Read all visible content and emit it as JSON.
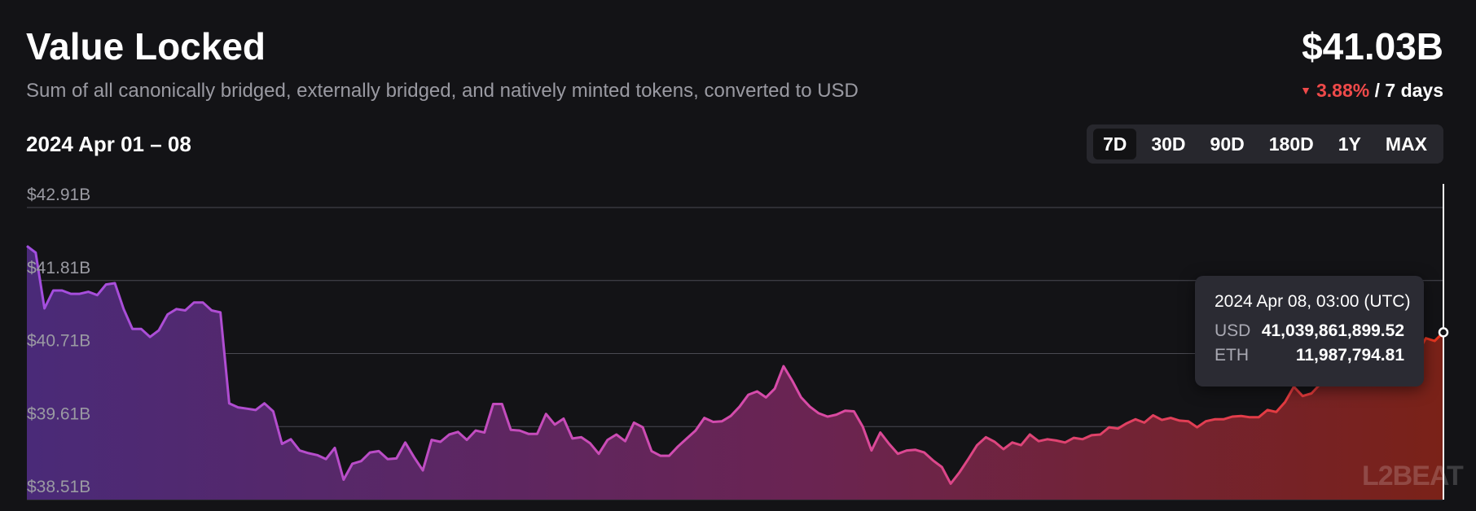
{
  "header": {
    "title": "Value Locked",
    "subtitle": "Sum of all canonically bridged, externally bridged, and natively minted tokens, converted to USD",
    "total_value": "$41.03B",
    "change_pct": "3.88%",
    "change_period": "/ 7 days",
    "date_range": "2024 Apr 01 – 08"
  },
  "tabs": [
    "7D",
    "30D",
    "90D",
    "180D",
    "1Y",
    "MAX"
  ],
  "active_tab": "7D",
  "tooltip": {
    "title": "2024 Apr 08, 03:00 (UTC)",
    "rows": [
      {
        "label": "USD",
        "value": "41,039,861,899.52"
      },
      {
        "label": "ETH",
        "value": "11,987,794.81"
      }
    ]
  },
  "watermark": "L2BEAT",
  "colors": {
    "background": "#131316",
    "negative": "#ef4a4a",
    "gradient_start": "#a24ee0",
    "gradient_mid": "#d94ba7",
    "gradient_end": "#e8361e"
  },
  "chart_data": {
    "type": "area",
    "y_tick_labels": [
      "$42.91B",
      "$41.81B",
      "$40.71B",
      "$39.61B",
      "$38.51B"
    ],
    "y_ticks": [
      42.91,
      41.81,
      40.71,
      39.61,
      38.51
    ],
    "ylim": [
      38.51,
      42.91
    ],
    "y_unit": "B USD",
    "x_start": "2024 Apr 01",
    "x_end": "2024 Apr 08",
    "grid": true,
    "values": [
      42.33,
      42.23,
      41.39,
      41.66,
      41.66,
      41.61,
      41.61,
      41.64,
      41.59,
      41.75,
      41.77,
      41.38,
      41.08,
      41.08,
      40.96,
      41.06,
      41.3,
      41.38,
      41.36,
      41.48,
      41.48,
      41.36,
      41.33,
      39.96,
      39.9,
      39.88,
      39.86,
      39.96,
      39.84,
      39.35,
      39.42,
      39.25,
      39.21,
      39.18,
      39.12,
      39.29,
      38.81,
      39.05,
      39.09,
      39.22,
      39.24,
      39.12,
      39.13,
      39.37,
      39.15,
      38.95,
      39.41,
      39.38,
      39.49,
      39.53,
      39.41,
      39.55,
      39.52,
      39.95,
      39.95,
      39.56,
      39.55,
      39.5,
      39.5,
      39.8,
      39.64,
      39.73,
      39.43,
      39.45,
      39.36,
      39.2,
      39.41,
      39.49,
      39.39,
      39.67,
      39.6,
      39.24,
      39.17,
      39.17,
      39.31,
      39.43,
      39.55,
      39.74,
      39.68,
      39.69,
      39.77,
      39.91,
      40.09,
      40.14,
      40.05,
      40.18,
      40.52,
      40.3,
      40.05,
      39.91,
      39.81,
      39.76,
      39.79,
      39.85,
      39.84,
      39.61,
      39.25,
      39.52,
      39.35,
      39.2,
      39.25,
      39.26,
      39.22,
      39.1,
      39.0,
      38.75,
      38.92,
      39.12,
      39.33,
      39.45,
      39.38,
      39.27,
      39.37,
      39.33,
      39.49,
      39.39,
      39.42,
      39.4,
      39.37,
      39.44,
      39.42,
      39.48,
      39.49,
      39.6,
      39.58,
      39.66,
      39.72,
      39.67,
      39.78,
      39.71,
      39.74,
      39.7,
      39.69,
      39.6,
      39.69,
      39.72,
      39.72,
      39.76,
      39.77,
      39.75,
      39.75,
      39.86,
      39.83,
      39.98,
      40.21,
      40.07,
      40.11,
      40.25,
      40.31,
      40.32,
      40.35,
      40.34,
      40.38,
      40.53,
      40.48,
      40.5,
      40.55,
      40.52,
      40.7,
      40.94,
      40.9,
      41.03
    ],
    "highlight_index": 161,
    "highlight_value": 41.03
  }
}
